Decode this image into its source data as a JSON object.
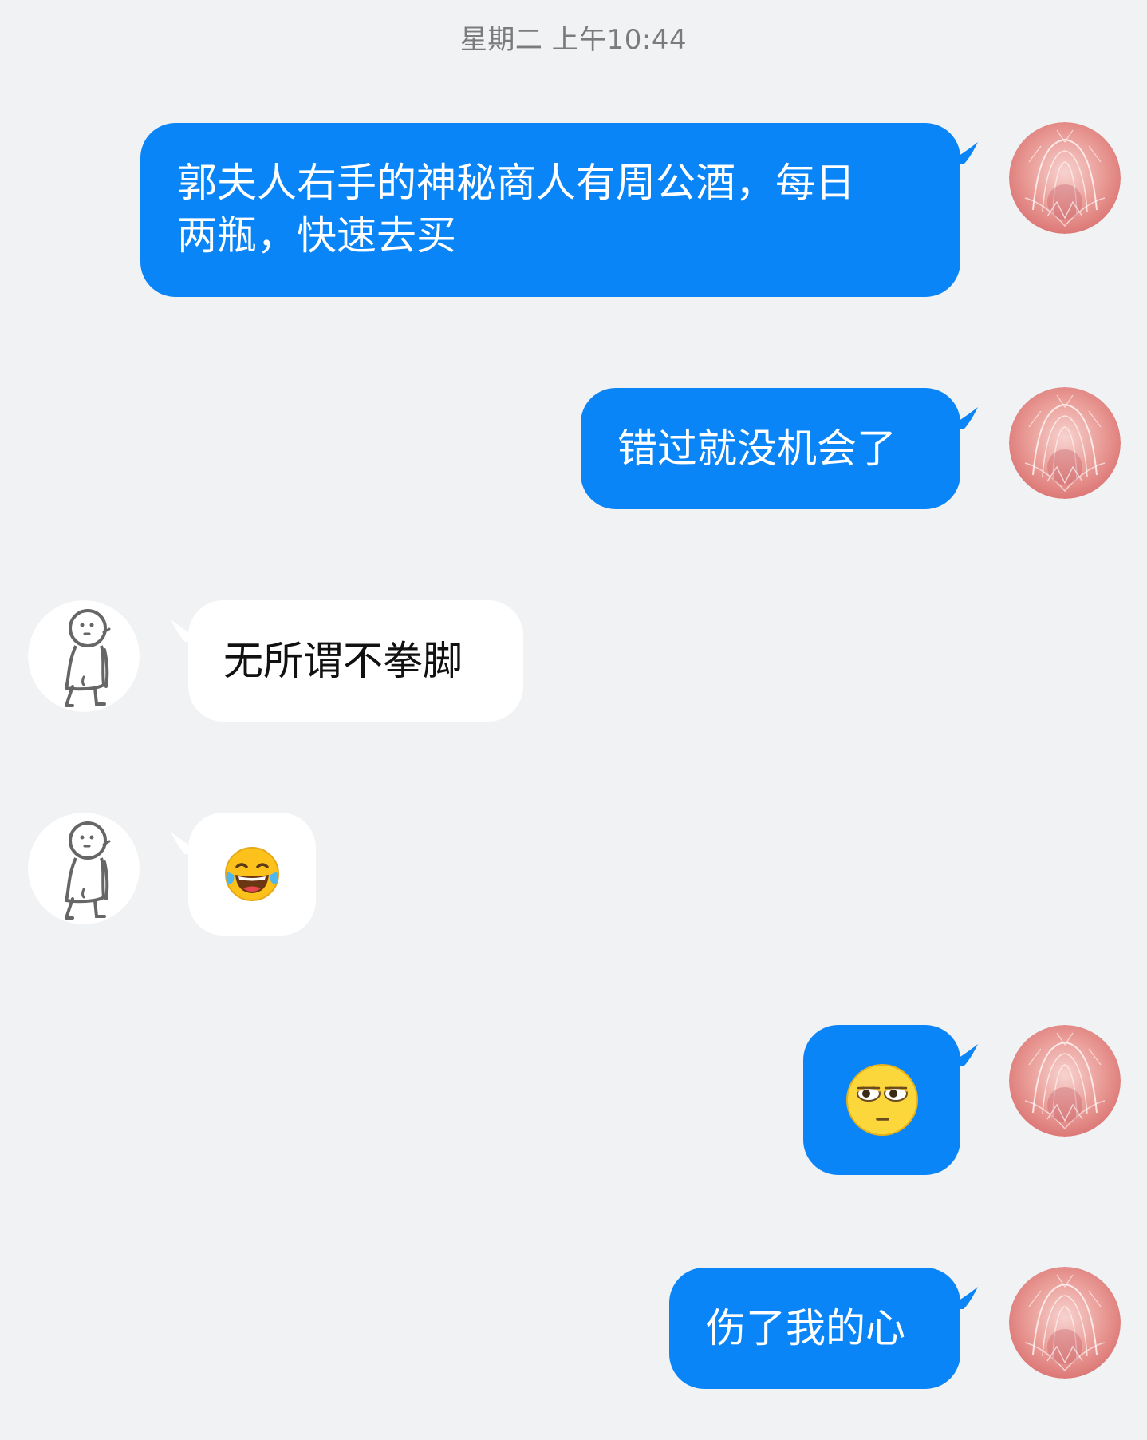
{
  "header": {
    "timestamp": "星期二 上午10:44"
  },
  "colors": {
    "background": "#f1f2f4",
    "outgoing_bubble": "#0a85f8",
    "incoming_bubble": "#ffffff",
    "outgoing_text": "#ffffff",
    "incoming_text": "#111111",
    "timestamp_text": "#7b7b7b"
  },
  "messages": [
    {
      "direction": "outgoing",
      "type": "text",
      "text": "郭夫人右手的神秘商人有周公酒，每日两瓶，快速去买",
      "avatar": "pink-nebula-avatar"
    },
    {
      "direction": "outgoing",
      "type": "text",
      "text": "错过就没机会了",
      "avatar": "pink-nebula-avatar"
    },
    {
      "direction": "incoming",
      "type": "text",
      "text": "无所谓不拳脚",
      "avatar": "stick-figure-avatar"
    },
    {
      "direction": "incoming",
      "type": "emoji",
      "emoji": "tears-of-joy-emoji",
      "avatar": "stick-figure-avatar"
    },
    {
      "direction": "outgoing",
      "type": "emoji",
      "emoji": "eye-roll-emoji",
      "avatar": "pink-nebula-avatar"
    },
    {
      "direction": "outgoing",
      "type": "text",
      "text": "伤了我的心",
      "avatar": "pink-nebula-avatar"
    }
  ]
}
